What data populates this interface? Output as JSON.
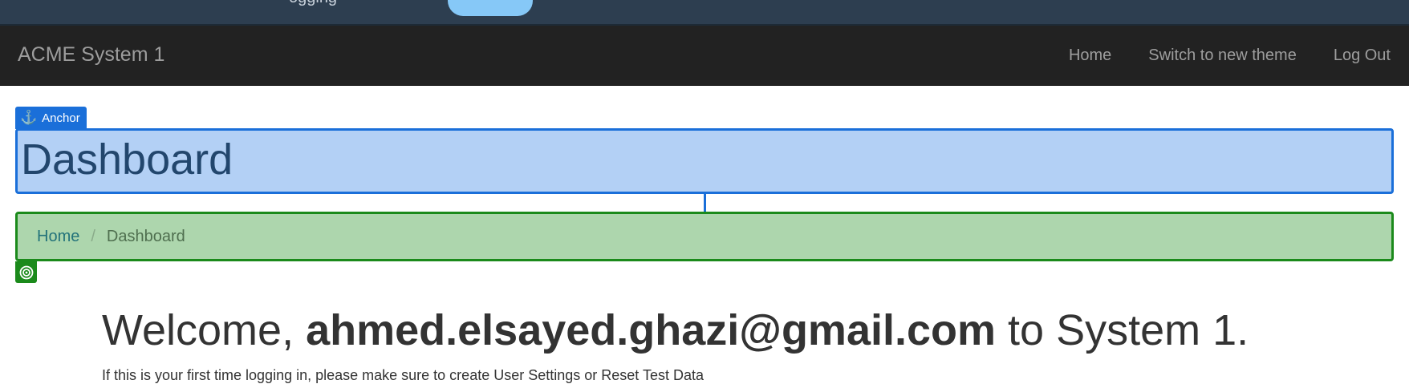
{
  "top_strip": {
    "fragment_text": "ogging"
  },
  "navbar": {
    "brand": "ACME System 1",
    "links": [
      "Home",
      "Switch to new theme",
      "Log Out"
    ]
  },
  "anchor_tag": {
    "label": "Anchor",
    "icon": "anchor-icon"
  },
  "page": {
    "title": "Dashboard",
    "breadcrumb": {
      "home": "Home",
      "separator": "/",
      "current": "Dashboard"
    },
    "welcome": {
      "prefix": "Welcome, ",
      "user": "ahmed.elsayed.ghazi@gmail.com",
      "suffix": " to System 1."
    },
    "cut_off_line": "If this is your first time logging in, please make sure to create User Settings or Reset Test Data"
  },
  "colors": {
    "navbar_bg": "#222222",
    "anchor_blue": "#1a6fd9",
    "highlight_blue": "#b3d0f5",
    "target_green": "#1b8a1b",
    "highlight_green": "#add6ad"
  }
}
